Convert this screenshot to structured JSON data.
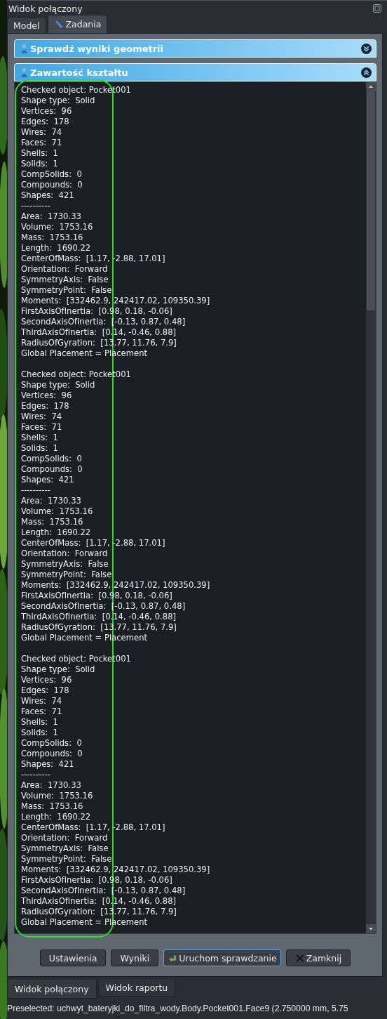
{
  "panel": {
    "title": "Widok połączony"
  },
  "tabs": [
    {
      "label": "Model",
      "selected": false,
      "kind": "plain"
    },
    {
      "label": "Zadania",
      "selected": true,
      "kind": "tasks"
    }
  ],
  "sections": [
    {
      "title": "Sprawdź wyniki geometrii",
      "expanded": false
    },
    {
      "title": "Zawartość kształtu",
      "expanded": true
    }
  ],
  "report": [
    {
      "lines": [
        "Checked object: Pocket001",
        "Shape type:  Solid",
        "Vertices:  96",
        "Edges:  178",
        "Wires:  74",
        "Faces:  71",
        "Shells:  1",
        "Solids:  1",
        "CompSolids:  0",
        "Compounds:  0",
        "Shapes:  421",
        "----------",
        "Area:  1730.33",
        "Volume:  1753.16",
        "Mass:  1753.16",
        "Length:  1690.22",
        "CenterOfMass:  [1.17, -2.88, 17.01]",
        "Orientation:  Forward",
        "SymmetryAxis:  False",
        "SymmetryPoint:  False",
        "Moments:  [332462.9, 242417.02, 109350.39]",
        "FirstAxisOfInertia:  [0.98, 0.18, -0.06]",
        "SecondAxisOfInertia:  [-0.13, 0.87, 0.48]",
        "ThirdAxisOfInertia:  [0.14, -0.46, 0.88]",
        "RadiusOfGyration:  [13.77, 11.76, 7.9]",
        "Global Placement = Placement"
      ]
    },
    {
      "lines": [
        "Checked object: Pocket001",
        "Shape type:  Solid",
        "Vertices:  96",
        "Edges:  178",
        "Wires:  74",
        "Faces:  71",
        "Shells:  1",
        "Solids:  1",
        "CompSolids:  0",
        "Compounds:  0",
        "Shapes:  421",
        "----------",
        "Area:  1730.33",
        "Volume:  1753.16",
        "Mass:  1753.16",
        "Length:  1690.22",
        "CenterOfMass:  [1.17, -2.88, 17.01]",
        "Orientation:  Forward",
        "SymmetryAxis:  False",
        "SymmetryPoint:  False",
        "Moments:  [332462.9, 242417.02, 109350.39]",
        "FirstAxisOfInertia:  [0.98, 0.18, -0.06]",
        "SecondAxisOfInertia:  [-0.13, 0.87, 0.48]",
        "ThirdAxisOfInertia:  [0.14, -0.46, 0.88]",
        "RadiusOfGyration:  [13.77, 11.76, 7.9]",
        "Global Placement = Placement"
      ]
    },
    {
      "lines": [
        "Checked object: Pocket001",
        "Shape type:  Solid",
        "Vertices:  96",
        "Edges:  178",
        "Wires:  74",
        "Faces:  71",
        "Shells:  1",
        "Solids:  1",
        "CompSolids:  0",
        "Compounds:  0",
        "Shapes:  421",
        "----------",
        "Area:  1730.33",
        "Volume:  1753.16",
        "Mass:  1753.16",
        "Length:  1690.22",
        "CenterOfMass:  [1.17, -2.88, 17.01]",
        "Orientation:  Forward",
        "SymmetryAxis:  False",
        "SymmetryPoint:  False",
        "Moments:  [332462.9, 242417.02, 109350.39]",
        "FirstAxisOfInertia:  [0.98, 0.18, -0.06]",
        "SecondAxisOfInertia:  [-0.13, 0.87, 0.48]",
        "ThirdAxisOfInertia:  [0.14, -0.46, 0.88]",
        "RadiusOfGyration:  [13.77, 11.76, 7.9]",
        "Global Placement = Placement"
      ]
    }
  ],
  "buttons": [
    {
      "label": "Ustawienia",
      "kind": "plain",
      "focused": false
    },
    {
      "label": "Wyniki",
      "kind": "plain",
      "focused": false
    },
    {
      "label": "Uruchom sprawdzanie",
      "kind": "run",
      "focused": true
    },
    {
      "label": "Zamknij",
      "kind": "close",
      "focused": false
    }
  ],
  "bottom_tabs": [
    {
      "label": "Widok połączony",
      "selected": true
    },
    {
      "label": "Widok raportu",
      "selected": false
    }
  ],
  "status_bar": "Preselected: uchwyt_bateryjki_do_filtra_wody.Body.Pocket001.Face9 (2.750000 mm, 5.75"
}
